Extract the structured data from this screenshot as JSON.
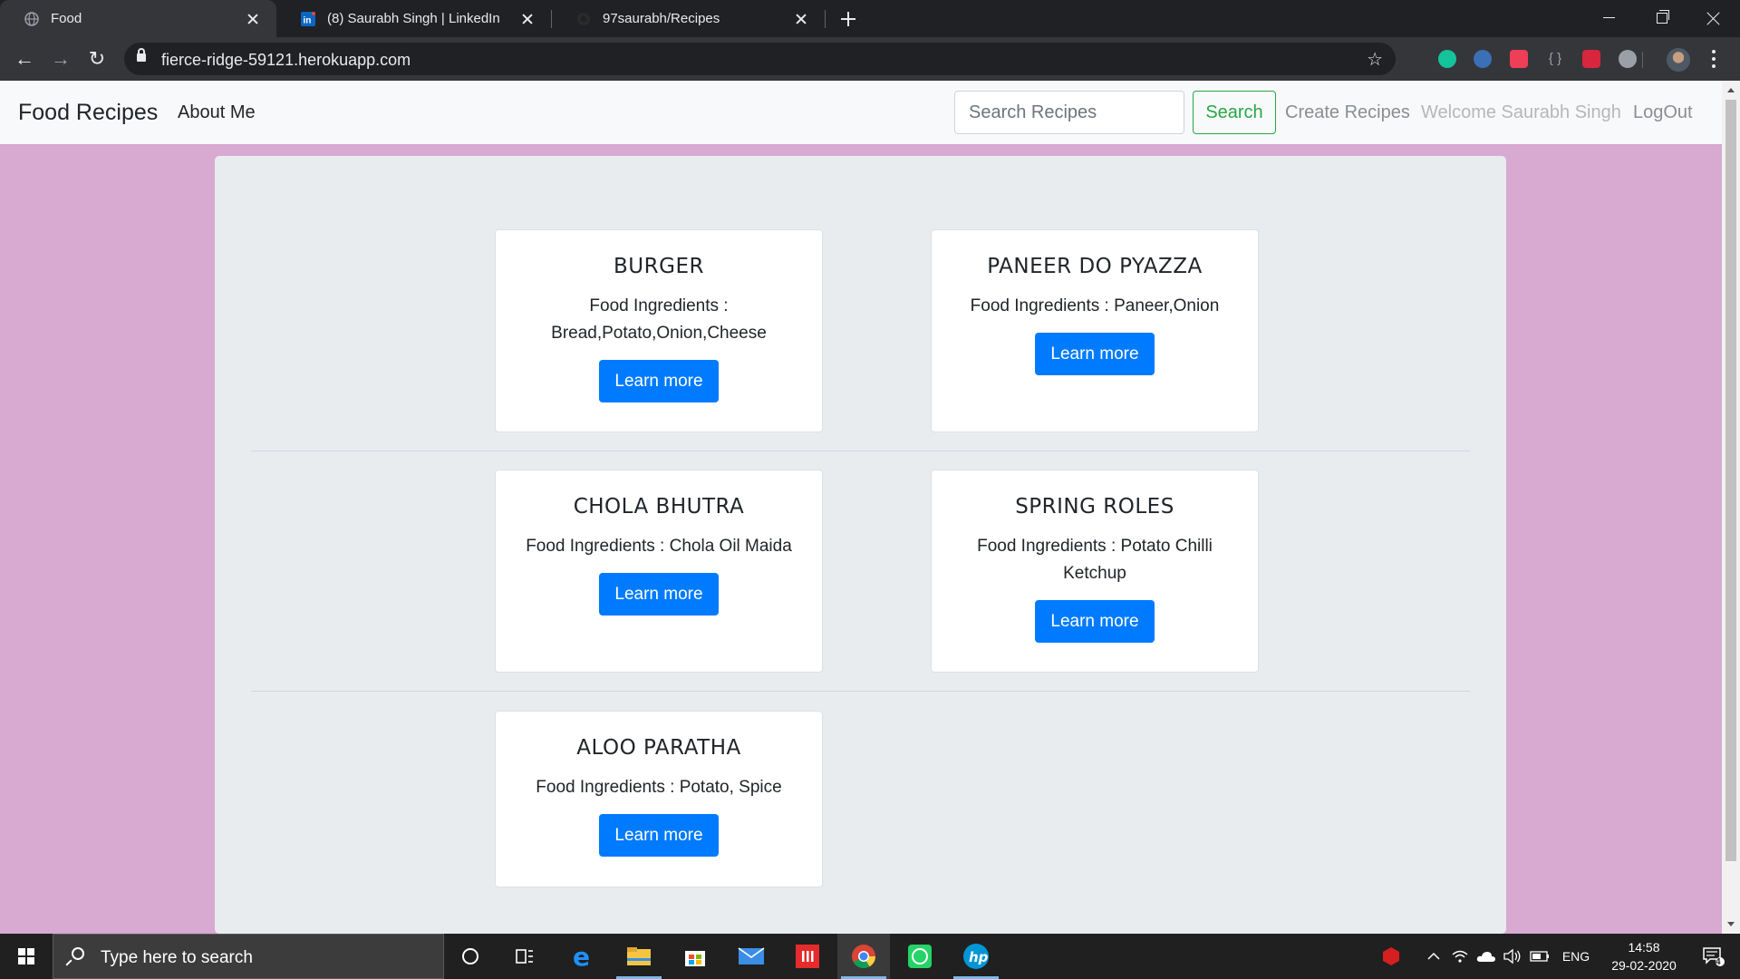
{
  "browser": {
    "tabs": [
      {
        "title": "Food",
        "active": true,
        "favicon": "globe-icon"
      },
      {
        "title": "(8) Saurabh Singh | LinkedIn",
        "active": false,
        "favicon": "linkedin-icon"
      },
      {
        "title": "97saurabh/Recipes",
        "active": false,
        "favicon": "github-icon"
      }
    ],
    "url": "fierce-ridge-59121.herokuapp.com",
    "extensions": [
      "grammarly-icon",
      "extension-icon",
      "pocket-icon",
      "json-viewer-icon",
      "bookmark-extension-icon",
      "key-icon"
    ]
  },
  "nav": {
    "brand": "Food Recipes",
    "about": "About Me",
    "search_placeholder": "Search Recipes",
    "search_button": "Search",
    "create": "Create Recipes",
    "welcome": "Welcome Saurabh Singh",
    "logout": "LogOut"
  },
  "recipes": [
    {
      "name": "BURGER",
      "ingredients": "Food Ingredients : Bread,Potato,Onion,Cheese",
      "button": "Learn more"
    },
    {
      "name": "PANEER DO PYAZZA",
      "ingredients": "Food Ingredients : Paneer,Onion",
      "button": "Learn more"
    },
    {
      "name": "CHOLA BHUTRA",
      "ingredients": "Food Ingredients : Chola Oil Maida",
      "button": "Learn more"
    },
    {
      "name": "SPRING ROLES",
      "ingredients": "Food Ingredients : Potato Chilli Ketchup",
      "button": "Learn more"
    },
    {
      "name": "ALOO PARATHA",
      "ingredients": "Food Ingredients : Potato, Spice",
      "button": "Learn more"
    }
  ],
  "taskbar": {
    "search_placeholder": "Type here to search",
    "apps": [
      "cortana-icon",
      "task-view-icon",
      "edge-icon",
      "file-explorer-icon",
      "store-icon",
      "mail-icon",
      "office-app-icon",
      "chrome-icon",
      "whatsapp-icon",
      "hp-icon"
    ],
    "language": "ENG",
    "time": "14:58",
    "date": "29-02-2020",
    "notifications": "4"
  },
  "colors": {
    "page_background": "#d8a9d1",
    "primary": "#007bff",
    "success": "#28a745",
    "container": "#e9ecef"
  }
}
